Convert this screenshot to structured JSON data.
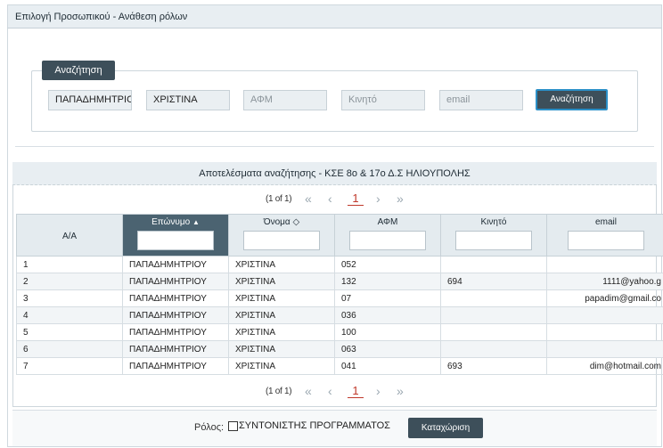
{
  "panel": {
    "title": "Επιλογή Προσωπικού - Ανάθεση ρόλων"
  },
  "search": {
    "legend": "Αναζήτηση",
    "surname_value": "ΠΑΠΑΔΗΜΗΤΡΙΟΥ",
    "name_value": "ΧΡΙΣΤΙΝΑ",
    "afm_placeholder": "ΑΦΜ",
    "mobile_placeholder": "Κινητό",
    "email_placeholder": "email",
    "button_label": "Αναζήτηση"
  },
  "results": {
    "title": "Αποτελέσματα αναζήτησης - ΚΣΕ 8ο & 17ο Δ.Σ ΗΛΙΟΥΠΟΛΗΣ",
    "pager": {
      "info": "(1 of 1)",
      "current_page": "1",
      "first": "«",
      "prev": "‹",
      "next": "›",
      "last": "»"
    },
    "columns": [
      "Α/Α",
      "Επώνυμο",
      "Όνομα",
      "ΑΦΜ",
      "Κινητό",
      "email"
    ],
    "rows": [
      [
        "1",
        "ΠΑΠΑΔΗΜΗΤΡΙΟΥ",
        "ΧΡΙΣΤΙΝΑ",
        "052",
        "",
        ""
      ],
      [
        "2",
        "ΠΑΠΑΔΗΜΗΤΡΙΟΥ",
        "ΧΡΙΣΤΙΝΑ",
        "132",
        "694",
        "1111@yahoo.g"
      ],
      [
        "3",
        "ΠΑΠΑΔΗΜΗΤΡΙΟΥ",
        "ΧΡΙΣΤΙΝΑ",
        "07",
        "",
        "papadim@gmail.co"
      ],
      [
        "4",
        "ΠΑΠΑΔΗΜΗΤΡΙΟΥ",
        "ΧΡΙΣΤΙΝΑ",
        "036",
        "",
        ""
      ],
      [
        "5",
        "ΠΑΠΑΔΗΜΗΤΡΙΟΥ",
        "ΧΡΙΣΤΙΝΑ",
        "100",
        "",
        ""
      ],
      [
        "6",
        "ΠΑΠΑΔΗΜΗΤΡΙΟΥ",
        "ΧΡΙΣΤΙΝΑ",
        "063",
        "",
        ""
      ],
      [
        "7",
        "ΠΑΠΑΔΗΜΗΤΡΙΟΥ",
        "ΧΡΙΣΤΙΝΑ",
        "041",
        "693",
        "dim@hotmail.com"
      ]
    ],
    "sorted_column": "Επώνυμο",
    "sort_icons": {
      "sorted": "sort-ascending-icon",
      "sortable": "sort-both-icon"
    }
  },
  "footer": {
    "role_label": "Ρόλος:",
    "role_option": "ΣΥΝΤΟΝΙΣΤΗΣ ΠΡΟΓΡΑΜΜΑΤΟΣ",
    "save_button": "Καταχώριση"
  },
  "colors": {
    "accent_dark": "#3d4f5a",
    "header_bg": "#e8eef2",
    "focus_border": "#2b8fc7",
    "page_active": "#c0392b"
  }
}
